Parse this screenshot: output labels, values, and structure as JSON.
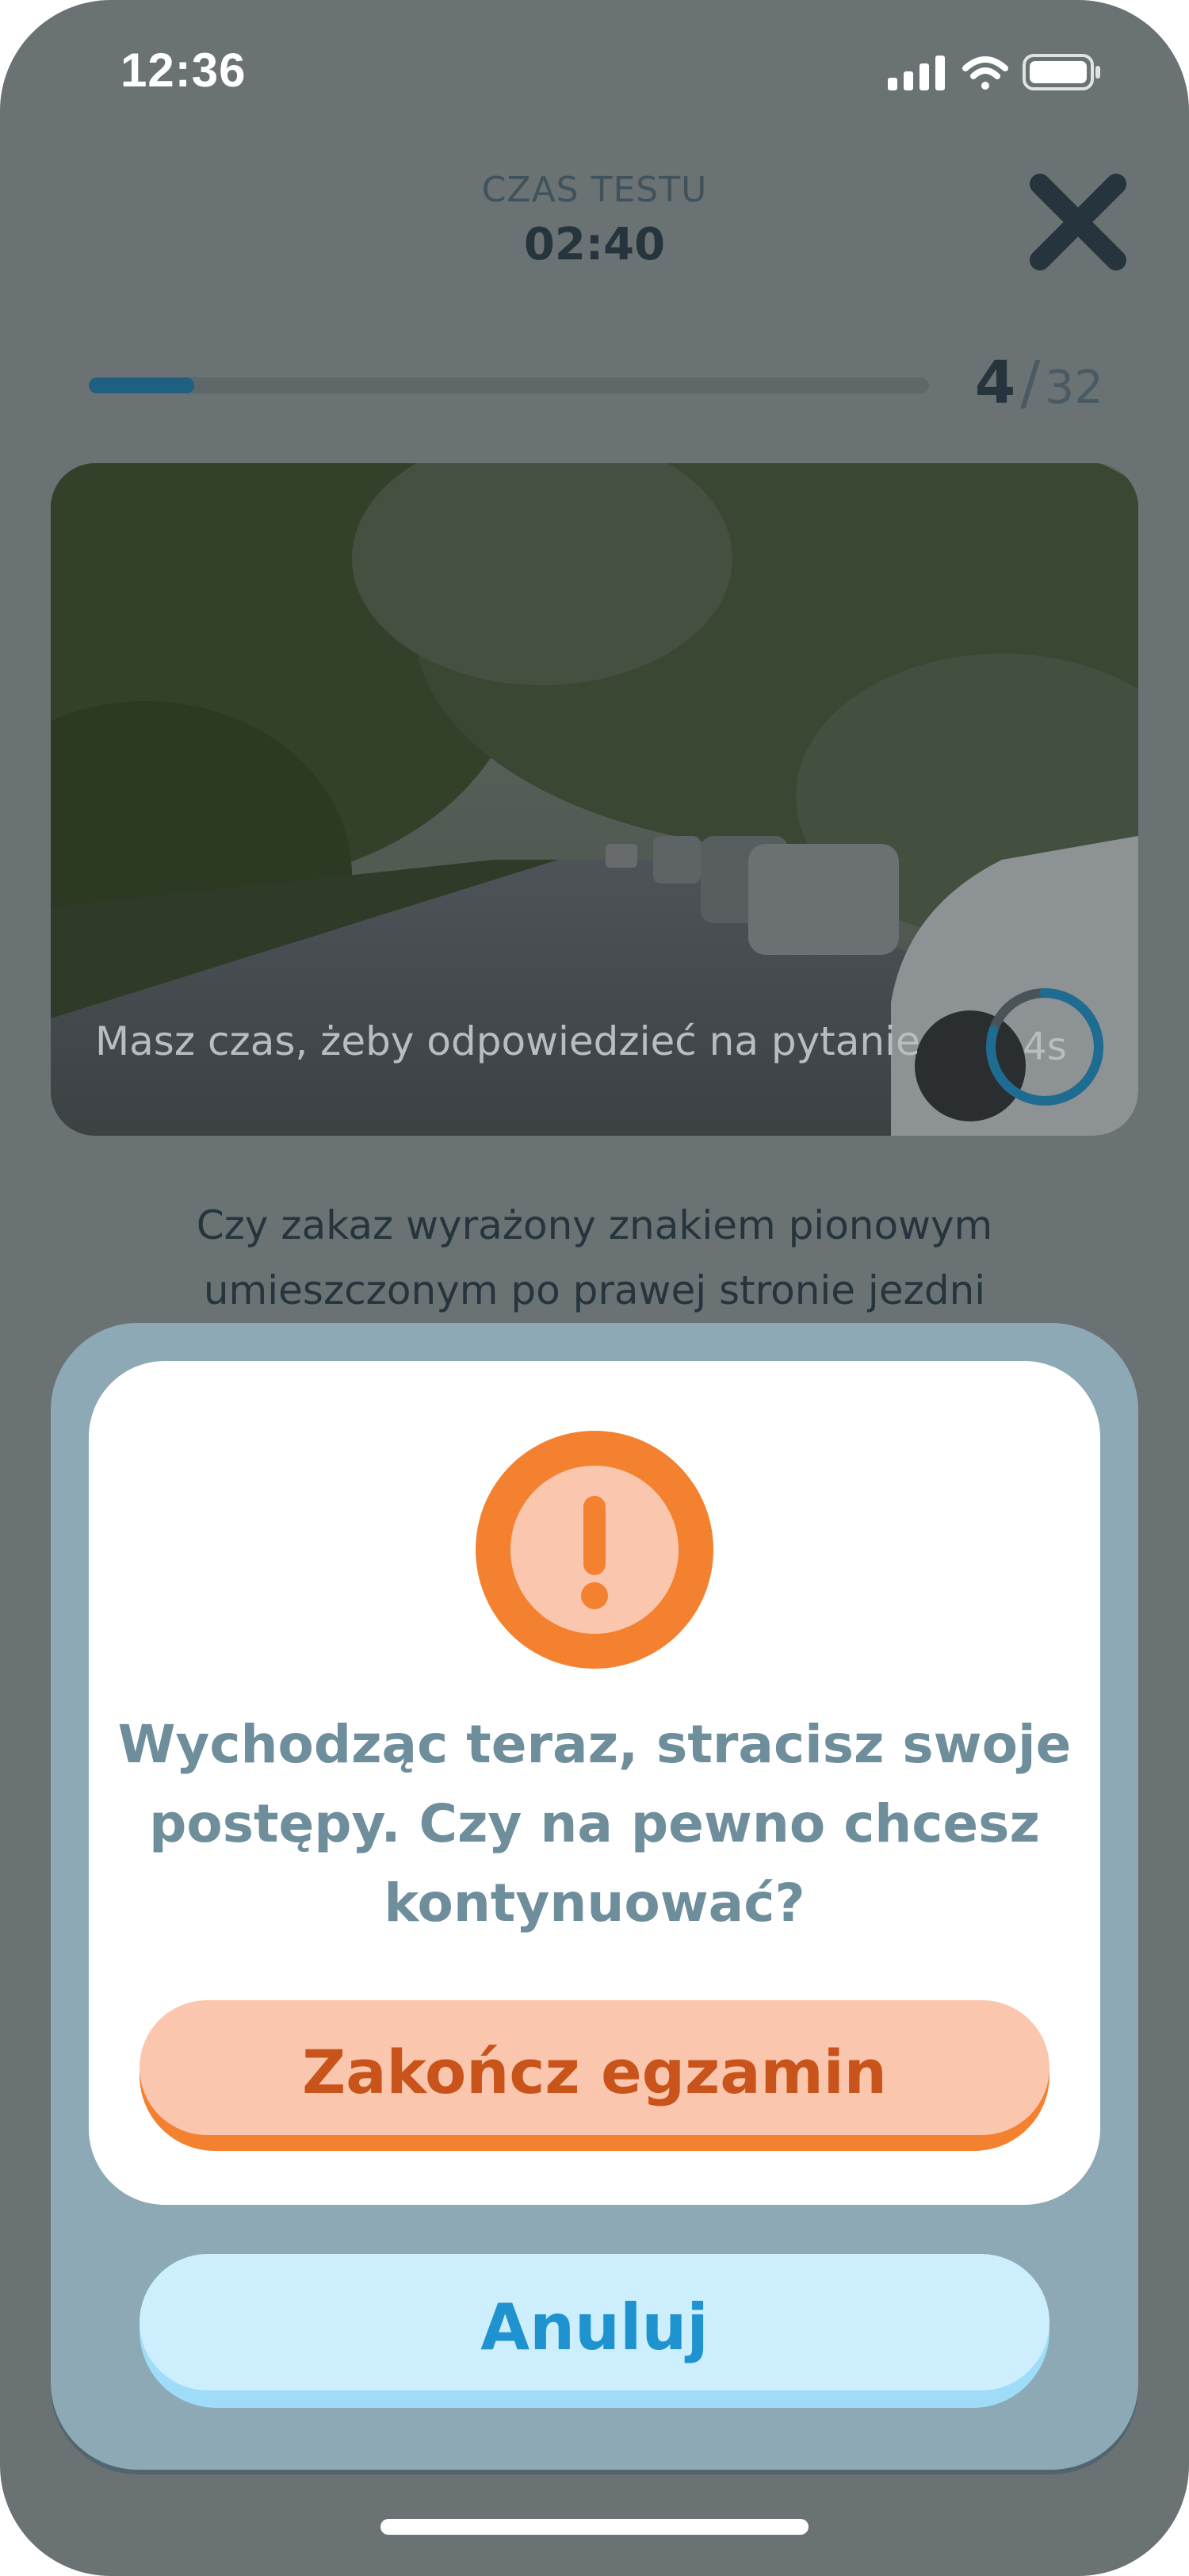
{
  "status_bar": {
    "time": "12:36",
    "signal_icon": "cellular-signal-icon",
    "wifi_icon": "wifi-icon",
    "battery_icon": "battery-icon"
  },
  "header": {
    "label": "CZAS TESTU",
    "timer": "02:40",
    "close_icon": "close-icon"
  },
  "progress": {
    "current": "4",
    "separator": "/",
    "total": "32",
    "fraction": 0.125
  },
  "video": {
    "caption": "Masz czas, żeby odpowiedzieć na pytanie",
    "countdown": "4s",
    "countdown_fraction": 0.8
  },
  "question": {
    "line1": "Czy zakaz wyrażony znakiem pionowym",
    "line2": "umieszczonym po prawej stronie jezdni"
  },
  "dialog": {
    "warning_icon": "exclamation-icon",
    "message_line1": "Wychodząc teraz, stracisz swoje",
    "message_line2": "postępy. Czy na pewno chcesz",
    "message_line3": "kontynuować?",
    "confirm_label": "Zakończ egzamin",
    "cancel_label": "Anuluj"
  },
  "colors": {
    "overlay": "#6a7273",
    "accent_orange": "#f38130",
    "accent_blue": "#1f93d0",
    "progress": "#1f5f82"
  }
}
